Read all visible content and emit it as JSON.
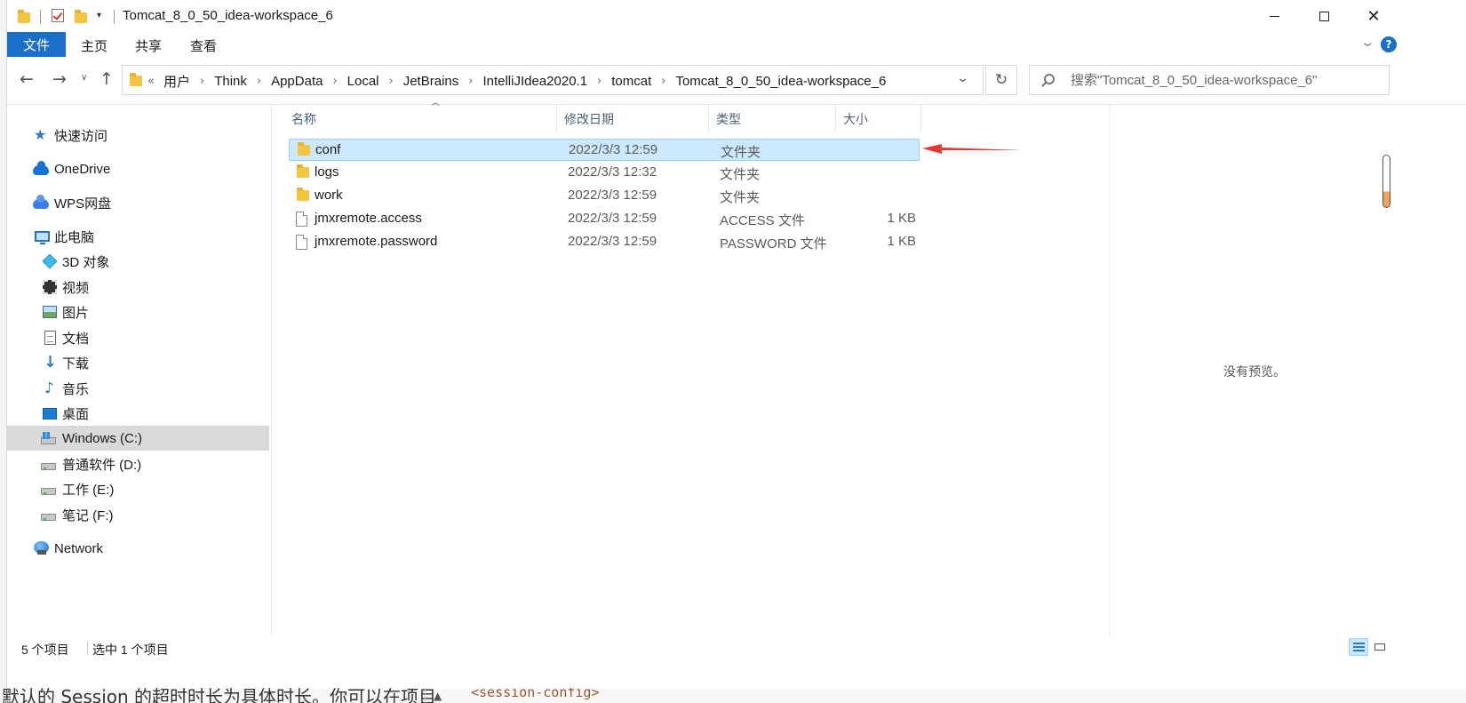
{
  "window": {
    "title": "Tomcat_8_0_50_idea-workspace_6",
    "minimize_icon": "minimize-icon",
    "maximize_icon": "maximize-icon",
    "close_icon": "close-icon"
  },
  "ribbon": {
    "tabs": [
      {
        "label": "文件"
      },
      {
        "label": "主页"
      },
      {
        "label": "共享"
      },
      {
        "label": "查看"
      }
    ]
  },
  "address": {
    "overflow": "«",
    "breadcrumbs": [
      "用户",
      "Think",
      "AppData",
      "Local",
      "JetBrains",
      "IntelliJIdea2020.1",
      "tomcat",
      "Tomcat_8_0_50_idea-workspace_6"
    ]
  },
  "search": {
    "placeholder": "搜索\"Tomcat_8_0_50_idea-workspace_6\""
  },
  "sidebar": {
    "items": [
      {
        "label": "快速访问",
        "icon": "star-icon"
      },
      {
        "label": "OneDrive",
        "icon": "cloud-icon"
      },
      {
        "label": "WPS网盘",
        "icon": "wps-cloud-icon"
      },
      {
        "label": "此电脑",
        "icon": "computer-icon"
      },
      {
        "label": "3D 对象",
        "icon": "cube-icon"
      },
      {
        "label": "视频",
        "icon": "film-icon"
      },
      {
        "label": "图片",
        "icon": "picture-icon"
      },
      {
        "label": "文档",
        "icon": "document-icon"
      },
      {
        "label": "下载",
        "icon": "download-icon"
      },
      {
        "label": "音乐",
        "icon": "music-icon"
      },
      {
        "label": "桌面",
        "icon": "desktop-icon"
      },
      {
        "label": "Windows (C:)",
        "icon": "windows-drive-icon"
      },
      {
        "label": "普通软件 (D:)",
        "icon": "drive-icon"
      },
      {
        "label": "工作 (E:)",
        "icon": "drive-icon"
      },
      {
        "label": "笔记 (F:)",
        "icon": "drive-icon"
      },
      {
        "label": "Network",
        "icon": "network-icon"
      }
    ]
  },
  "filelist": {
    "columns": [
      "名称",
      "修改日期",
      "类型",
      "大小"
    ],
    "rows": [
      {
        "name": "conf",
        "date": "2022/3/3 12:59",
        "type": "文件夹",
        "size": "",
        "icon": "folder-icon"
      },
      {
        "name": "logs",
        "date": "2022/3/3 12:32",
        "type": "文件夹",
        "size": "",
        "icon": "folder-icon"
      },
      {
        "name": "work",
        "date": "2022/3/3 12:59",
        "type": "文件夹",
        "size": "",
        "icon": "folder-icon"
      },
      {
        "name": "jmxremote.access",
        "date": "2022/3/3 12:59",
        "type": "ACCESS 文件",
        "size": "1 KB",
        "icon": "file-icon"
      },
      {
        "name": "jmxremote.password",
        "date": "2022/3/3 12:59",
        "type": "PASSWORD 文件",
        "size": "1 KB",
        "icon": "file-icon"
      }
    ]
  },
  "preview": {
    "text": "没有预览。"
  },
  "status": {
    "item_count": "5 个项目",
    "selected": "选中 1 个项目"
  },
  "background": {
    "bottom_text": "默认的 Session 的超时时长为具体时长。你可以在项目",
    "bottom_code": "<session-config>"
  },
  "colors": {
    "accent": "#1a6fc9",
    "selection": "#cce8ff",
    "annotation_arrow": "#e53935"
  }
}
